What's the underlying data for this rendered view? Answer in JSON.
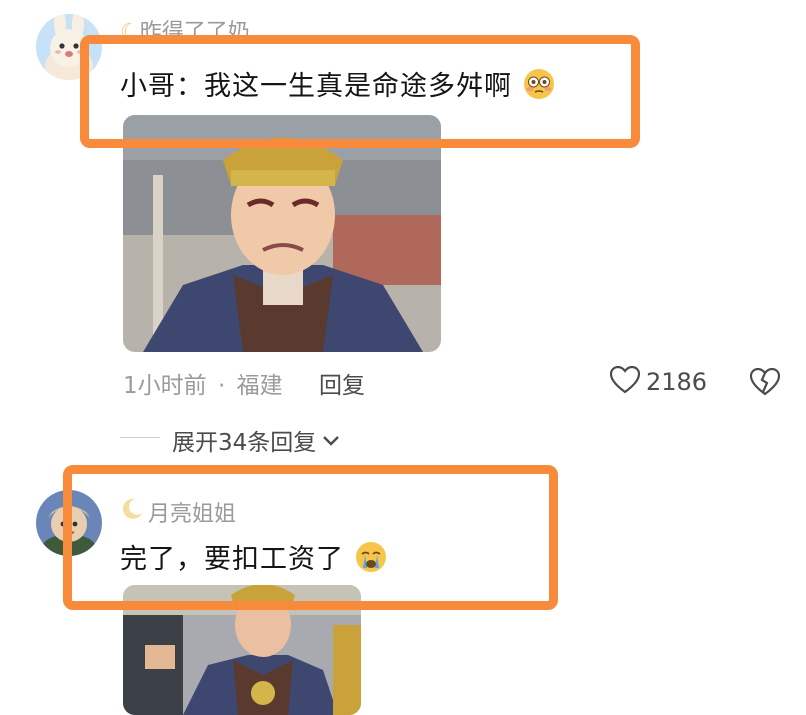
{
  "comments": [
    {
      "username": "昨得了了奶",
      "username_prefix_icon": "moon-icon",
      "text": "小哥：我这一生真是命途多舛啊",
      "emoji": "flushed-face",
      "image": "meme-crying-general",
      "time": "1小时前",
      "separator": "·",
      "location": "福建",
      "reply_label": "回复",
      "likes": "2186"
    },
    {
      "username": "月亮姐姐",
      "username_prefix_icon": "crescent-moon-icon",
      "text": "完了，要扣工资了",
      "emoji": "crying-face",
      "image": "meme-sad-general"
    }
  ],
  "expand_replies": {
    "label": "展开34条回复"
  },
  "colors": {
    "highlight": "#f78a3b",
    "meta_gray": "#9b9b9b"
  }
}
